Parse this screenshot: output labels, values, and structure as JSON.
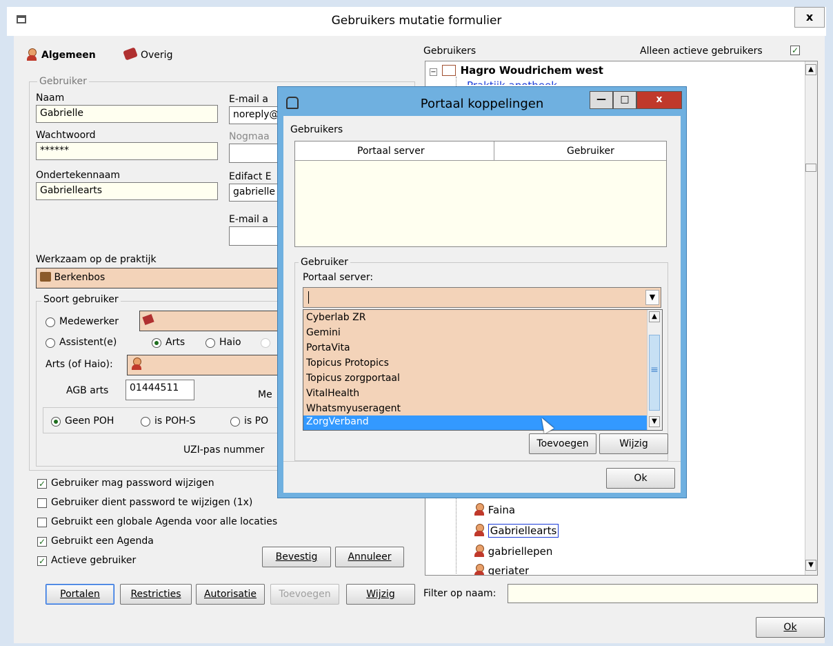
{
  "window": {
    "title": "Gebruikers mutatie formulier",
    "close": "x"
  },
  "tabs": [
    {
      "label": "Algemeen"
    },
    {
      "label": "Overig"
    }
  ],
  "gebruiker_group": {
    "title": "Gebruiker",
    "naam_label": "Naam",
    "naam_value": "Gabrielle",
    "email_label": "E-mail a",
    "email_value": "noreply@",
    "wachtwoord_label": "Wachtwoord",
    "wachtwoord_value": "******",
    "nogmaals_label": "Nogmaa",
    "onderteken_label": "Ondertekennaam",
    "onderteken_value": "Gabriellearts",
    "edifact_label": "Edifact E",
    "edifact_value": "gabrielle",
    "email2_label": "E-mail a"
  },
  "werkzaam": {
    "label": "Werkzaam op de praktijk",
    "value": "Berkenbos"
  },
  "soort": {
    "title": "Soort gebruiker",
    "medewerker": "Medewerker",
    "assistent": "Assistent(e)",
    "arts": "Arts",
    "haio": "Haio",
    "arts_of_haio_label": "Arts (of Haio):",
    "agb_label": "AGB arts",
    "agb_value": "01444511",
    "me_label": "Me",
    "geen_poh": "Geen POH",
    "is_poh_s": "is POH-S",
    "is_po": "is PO",
    "uzi_label": "UZI-pas nummer"
  },
  "checks": [
    {
      "label": "Gebruiker mag password wijzigen",
      "checked": true
    },
    {
      "label": "Gebruiker dient password te wijzigen (1x)",
      "checked": false
    },
    {
      "label": "Gebruikt een globale Agenda voor alle locaties",
      "checked": false
    },
    {
      "label": "Gebruikt een Agenda",
      "checked": true
    },
    {
      "label": "Actieve gebruiker",
      "checked": true
    }
  ],
  "buttons": {
    "bevestig": "Bevestig",
    "annuleer": "Annuleer",
    "portalen": "Portalen",
    "restricties": "Restricties",
    "autorisatie": "Autorisatie",
    "toevoegen": "Toevoegen",
    "wijzig": "Wijzig",
    "ok": "Ok"
  },
  "right_panel": {
    "gebruikers_label": "Gebruikers",
    "alleen_actief": "Alleen actieve gebruikers",
    "tree_root": "Hagro Woudrichem west",
    "tree_partial": "Praktijk apotheek",
    "users": [
      "Faina",
      "Gabriellearts",
      "gabriellepen",
      "geriater"
    ],
    "filter_label": "Filter op naam:"
  },
  "dialog": {
    "title": "Portaal koppelingen",
    "gebruikers_label": "Gebruikers",
    "columns": [
      "Portaal server",
      "Gebruiker"
    ],
    "group_title": "Gebruiker",
    "portaal_label": "Portaal server:",
    "combo_value": "",
    "options": [
      "Cyberlab ZR",
      "Gemini",
      "PortaVita",
      "Topicus Protopics",
      "Topicus zorgportaal",
      "VitalHealth",
      "Whatsmyuseragent",
      "ZorgVerband"
    ],
    "selected": "ZorgVerband",
    "toevoegen": "Toevoegen",
    "wijzig": "Wijzig",
    "ok": "Ok"
  },
  "colors": {
    "accent": "#3399ff",
    "tan": "#f3d3b9",
    "titlebar": "#6fb0e0",
    "close_red": "#c0392b"
  }
}
